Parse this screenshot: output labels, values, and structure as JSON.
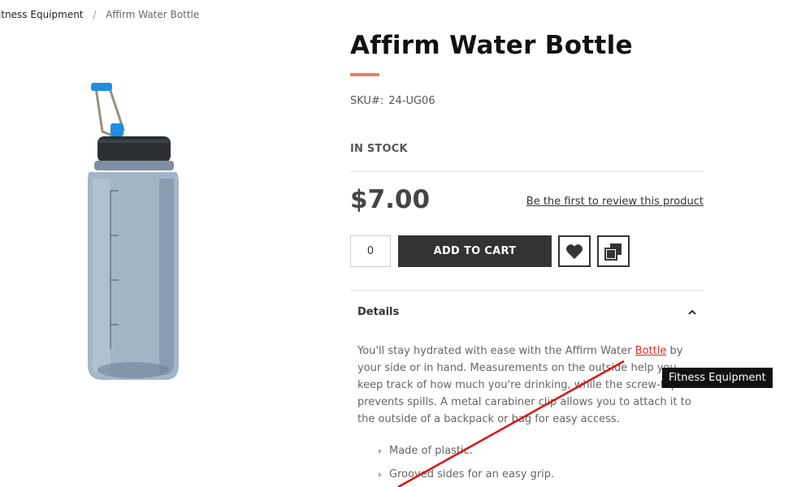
{
  "breadcrumb": {
    "parent": "Fitness Equipment",
    "separator": "/",
    "current": "Affirm Water Bottle"
  },
  "product": {
    "title": "Affirm Water Bottle",
    "sku_label": "SKU#:",
    "sku_value": "24-UG06",
    "stock": "IN STOCK",
    "price": "$7.00",
    "review_link": "Be the first to review this product",
    "quantity": "0",
    "add_to_cart_label": "ADD TO CART",
    "image_icon": "water-bottle-image"
  },
  "details": {
    "heading": "Details",
    "description_before": "You'll stay hydrated with ease with the Affirm Water ",
    "description_link": "Bottle",
    "description_after": " by your side or in hand. Measurements on the outside help you keep track of how much you're drinking, while the screw-top lid prevents spills. A metal carabiner clip allows you to attach it to the outside of a backpack or bag for easy access.",
    "features": [
      "Made of plastic.",
      "Grooved sides for an easy grip."
    ]
  },
  "tooltip": {
    "text": "Fitness Equipment"
  },
  "colors": {
    "accent": "#e8825c",
    "button": "#333333",
    "link_highlight": "#e02b27"
  }
}
